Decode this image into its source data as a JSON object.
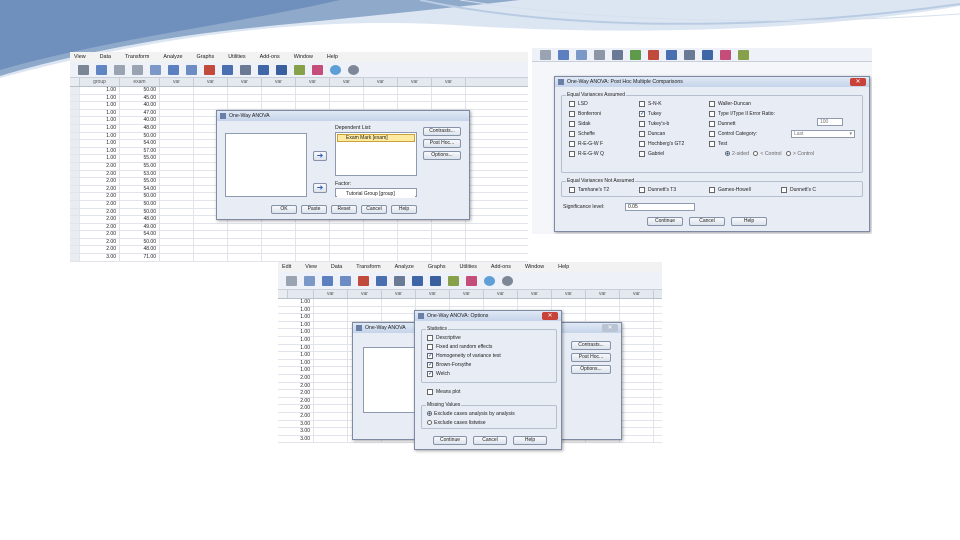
{
  "spss_main": {
    "menu": [
      "View",
      "Data",
      "Transform",
      "Analyze",
      "Graphs",
      "Utilities",
      "Add-ons",
      "Window",
      "Help"
    ],
    "columns": [
      "group",
      "exam",
      "var",
      "var",
      "var",
      "var",
      "var",
      "var",
      "var",
      "var",
      "var"
    ],
    "rows": [
      [
        "1.00",
        "50.00"
      ],
      [
        "1.00",
        "45.00"
      ],
      [
        "1.00",
        "40.00"
      ],
      [
        "1.00",
        "47.00"
      ],
      [
        "1.00",
        "40.00"
      ],
      [
        "1.00",
        "48.00"
      ],
      [
        "1.00",
        "50.00"
      ],
      [
        "1.00",
        "54.00"
      ],
      [
        "1.00",
        "57.00"
      ],
      [
        "1.00",
        "55.00"
      ],
      [
        "2.00",
        "55.00"
      ],
      [
        "2.00",
        "53.00"
      ],
      [
        "2.00",
        "55.00"
      ],
      [
        "2.00",
        "54.00"
      ],
      [
        "2.00",
        "50.00"
      ],
      [
        "2.00",
        "50.00"
      ],
      [
        "2.00",
        "50.00"
      ],
      [
        "2.00",
        "48.00"
      ],
      [
        "2.00",
        "49.00"
      ],
      [
        "2.00",
        "54.00"
      ],
      [
        "2.00",
        "50.00"
      ],
      [
        "2.00",
        "48.00"
      ],
      [
        "3.00",
        "71.00"
      ]
    ]
  },
  "oneway_dialog": {
    "title": "One-Way ANOVA",
    "dependent_label": "Dependent List:",
    "dependent_item": "Exam Mark [exam]",
    "factor_label": "Factor:",
    "factor_item": "Tutorial Group [group]",
    "side_buttons": [
      "Contrasts...",
      "Post Hoc...",
      "Options..."
    ],
    "bottom_buttons": [
      "OK",
      "Paste",
      "Reset",
      "Cancel",
      "Help"
    ]
  },
  "posthoc_dialog": {
    "title": "One-Way ANOVA: Post Hoc Multiple Comparisons",
    "equal_group": "Equal Variances Assumed",
    "equal_options": [
      {
        "label": "LSD",
        "checked": false
      },
      {
        "label": "S-N-K",
        "checked": false
      },
      {
        "label": "Waller-Duncan",
        "checked": false
      },
      {
        "label": "Bonferroni",
        "checked": false
      },
      {
        "label": "Tukey",
        "checked": true
      },
      {
        "label": "Type I/Type II Error Ratio:",
        "checked": false
      },
      {
        "label": "Sidak",
        "checked": false
      },
      {
        "label": "Tukey's-b",
        "checked": false
      },
      {
        "label": "Dunnett",
        "checked": false
      },
      {
        "label": "Scheffe",
        "checked": false
      },
      {
        "label": "Duncan",
        "checked": false
      },
      {
        "label": "Control Category:",
        "checked": false
      },
      {
        "label": "R-E-G-W F",
        "checked": false
      },
      {
        "label": "Hochberg's GT2",
        "checked": false
      },
      {
        "label": "Test",
        "checked": false
      },
      {
        "label": "R-E-G-W Q",
        "checked": false
      },
      {
        "label": "Gabriel",
        "checked": false
      }
    ],
    "ratio_value": "100",
    "control_value": "Last",
    "test_options": [
      "2-sided",
      "< Control",
      "> Control"
    ],
    "not_equal_group": "Equal Variances Not Assumed",
    "not_equal_options": [
      "Tamhane's T2",
      "Dunnett's T3",
      "Games-Howell",
      "Dunnett's C"
    ],
    "sig_label": "Significance level:",
    "sig_value": "0.05",
    "buttons": [
      "Continue",
      "Cancel",
      "Help"
    ]
  },
  "spss_second": {
    "menu": [
      "Edit",
      "View",
      "Data",
      "Transform",
      "Analyze",
      "Graphs",
      "Utilities",
      "Add-ons",
      "Window",
      "Help"
    ],
    "columns": [
      "var",
      "var",
      "var",
      "var",
      "var",
      "var",
      "var",
      "var",
      "var",
      "var"
    ],
    "rows": [
      "1.00",
      "1.00",
      "1.00",
      "1.00",
      "1.00",
      "1.00",
      "1.00",
      "1.00",
      "1.00",
      "1.00",
      "2.00",
      "2.00",
      "2.00",
      "2.00",
      "2.00",
      "2.00",
      "3.00",
      "3.00",
      "3.00"
    ]
  },
  "oneway_bg_dialog": {
    "title": "One-Way ANOVA",
    "side_buttons": [
      "Contrasts...",
      "Post Hoc...",
      "Options..."
    ]
  },
  "options_dialog": {
    "title": "One-Way ANOVA: Options",
    "statistics_group": "Statistics",
    "statistics": [
      {
        "label": "Descriptive",
        "checked": false
      },
      {
        "label": "Fixed and random effects",
        "checked": false
      },
      {
        "label": "Homogeneity of variance test",
        "checked": true
      },
      {
        "label": "Brown-Forsythe",
        "checked": true
      },
      {
        "label": "Welch",
        "checked": true
      }
    ],
    "means_plot": "Means plot",
    "missing_group": "Missing Values",
    "missing": [
      {
        "label": "Exclude cases analysis by analysis",
        "on": true
      },
      {
        "label": "Exclude cases listwise",
        "on": false
      }
    ],
    "buttons": [
      "Continue",
      "Cancel",
      "Help"
    ]
  },
  "colors": {
    "accent": "#7fa2cf",
    "title_bar": "#c5d4ea",
    "close": "#c9423a"
  }
}
